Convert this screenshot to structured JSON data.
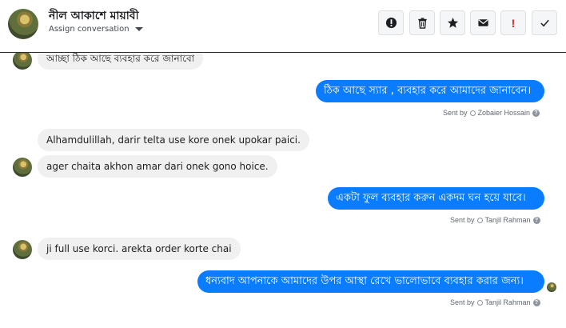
{
  "header": {
    "contact_name": "নীল আকাশে মায়াবী",
    "assign_label": "Assign conversation"
  },
  "toolbar": {
    "buttons": [
      {
        "name": "alert-icon"
      },
      {
        "name": "trash-icon"
      },
      {
        "name": "star-icon"
      },
      {
        "name": "envelope-icon"
      },
      {
        "name": "exclamation-icon",
        "label": "!"
      },
      {
        "name": "check-icon"
      }
    ]
  },
  "messages": [
    {
      "dir": "in",
      "text": "আচ্ছা ঠিক আছে ব্যবহার করে জানাবো"
    },
    {
      "dir": "out",
      "text": "ঠিক আছে স্যার , ব্যবহার করে আমাদের জানাবেন।",
      "sent_prefix": "Sent by",
      "sender": "Zobaier Hossain",
      "help": "?"
    },
    {
      "dir": "in",
      "text": "Alhamdulillah, darir telta use kore onek upokar paici."
    },
    {
      "dir": "in",
      "text": "ager chaita akhon amar dari onek gono hoice."
    },
    {
      "dir": "out",
      "text": "একটা ফুল ব্যবহার করুন একদম ঘন হয়ে যাবে।",
      "sent_prefix": "Sent by",
      "sender": "Tanjil Rahman",
      "help": "?"
    },
    {
      "dir": "in",
      "text": "ji full use korci. arekta order korte chai"
    },
    {
      "dir": "out",
      "text": "ধন্যবাদ আপনাকে আমাদের উপর আস্থা রেখে  ভালোভাবে ব্যবহার করার জন্য।",
      "sent_prefix": "Sent by",
      "sender": "Tanjil Rahman",
      "help": "?"
    }
  ],
  "colors": {
    "outgoing_bubble": "#0a7cff",
    "incoming_bubble": "#f1f0f0",
    "alert_red": "#e02020"
  }
}
